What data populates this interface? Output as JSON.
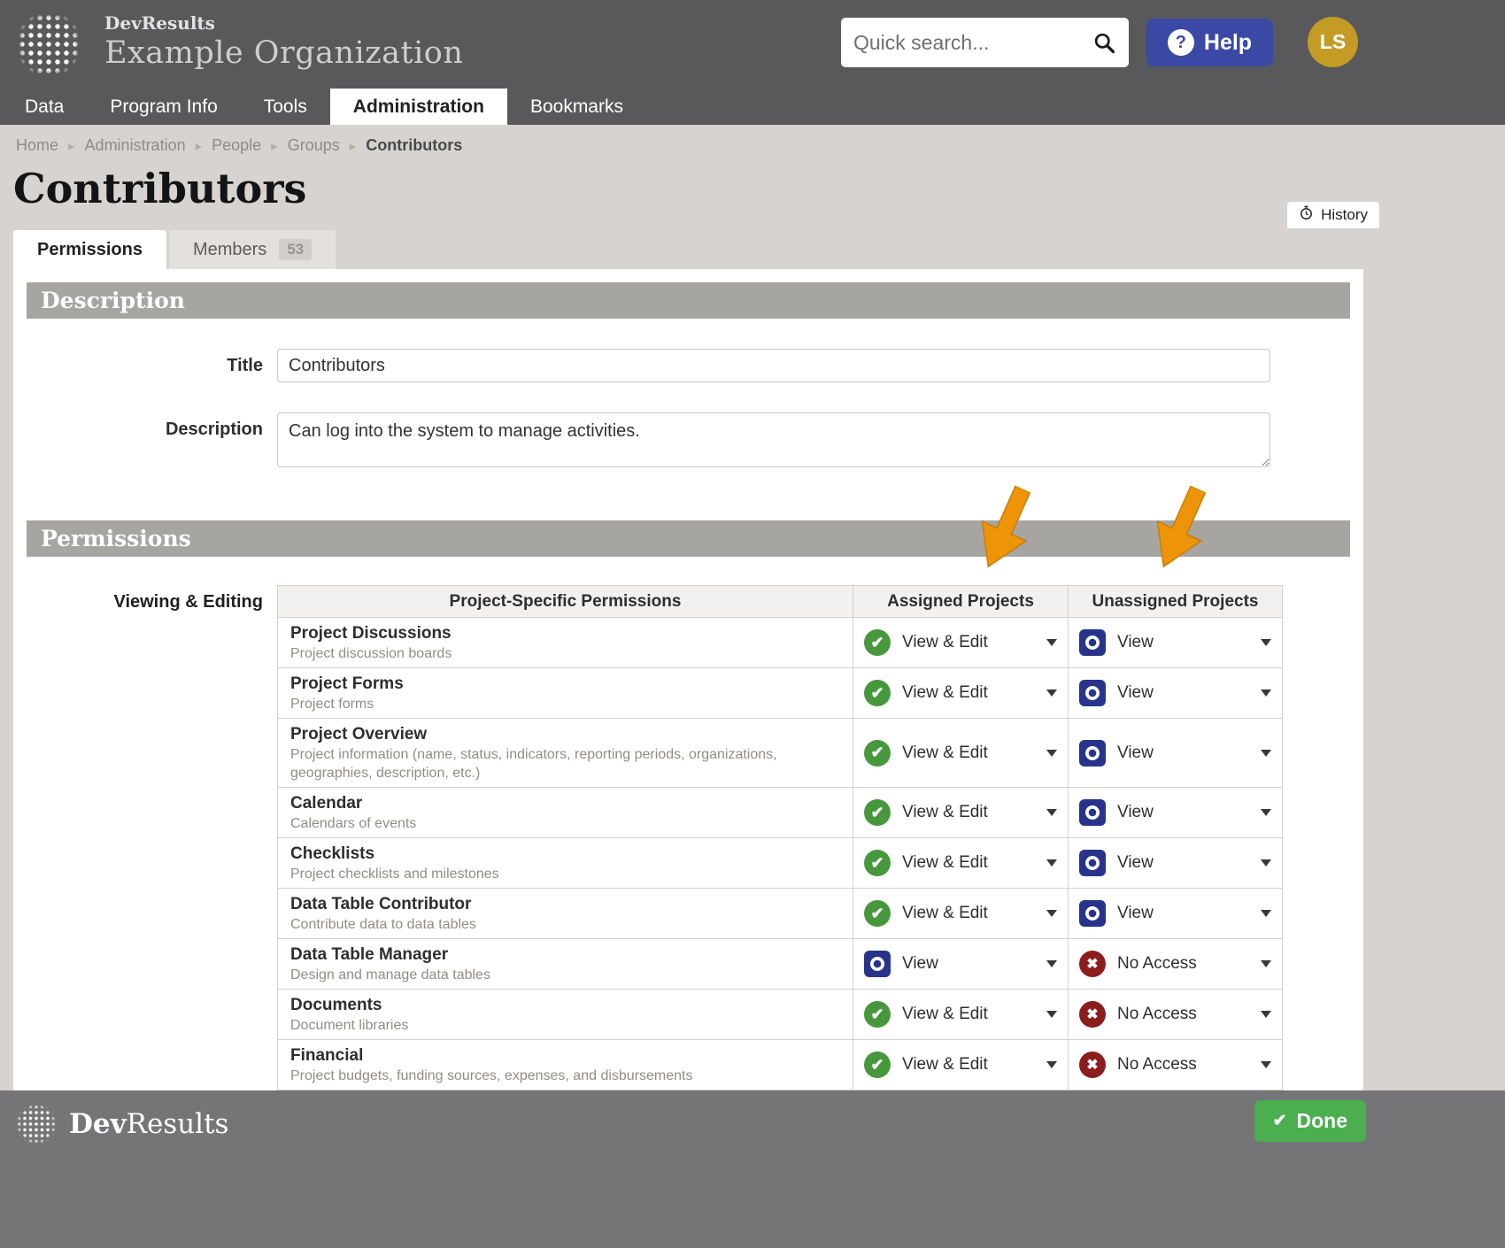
{
  "colors": {
    "header_gray": "#59595b",
    "accent_green": "#47983d",
    "accent_blue": "#28348b",
    "accent_red": "#8c1d1d",
    "arrow_orange": "#ee9408",
    "help_blue": "#3a49a3",
    "done_green": "#4bae4f",
    "avatar_gold": "#c49b25"
  },
  "header": {
    "app_name": "DevResults",
    "org_name": "Example Organization",
    "search_placeholder": "Quick search...",
    "help_label": "Help",
    "avatar_initials": "LS"
  },
  "nav": {
    "items": [
      {
        "label": "Data",
        "active": false
      },
      {
        "label": "Program Info",
        "active": false
      },
      {
        "label": "Tools",
        "active": false
      },
      {
        "label": "Administration",
        "active": true
      },
      {
        "label": "Bookmarks",
        "active": false
      }
    ]
  },
  "breadcrumb": {
    "items": [
      "Home",
      "Administration",
      "People",
      "Groups",
      "Contributors"
    ]
  },
  "page": {
    "title": "Contributors",
    "history_label": "History"
  },
  "tabs": {
    "permissions": {
      "label": "Permissions"
    },
    "members": {
      "label": "Members",
      "badge": "53"
    }
  },
  "description_section": {
    "header": "Description",
    "title_label": "Title",
    "title_value": "Contributors",
    "description_label": "Description",
    "description_value": "Can log into the system to manage activities."
  },
  "permissions_section": {
    "header": "Permissions",
    "group_label": "Viewing & Editing",
    "columns": [
      "Project-Specific Permissions",
      "Assigned Projects",
      "Unassigned Projects"
    ],
    "rows": [
      {
        "name": "Project Discussions",
        "desc": "Project discussion boards",
        "assigned": {
          "label": "View & Edit",
          "state": "view_edit"
        },
        "unassigned": {
          "label": "View",
          "state": "view"
        }
      },
      {
        "name": "Project Forms",
        "desc": "Project forms",
        "assigned": {
          "label": "View & Edit",
          "state": "view_edit"
        },
        "unassigned": {
          "label": "View",
          "state": "view"
        }
      },
      {
        "name": "Project Overview",
        "desc": "Project information (name, status, indicators, reporting periods, organizations, geographies, description, etc.)",
        "assigned": {
          "label": "View & Edit",
          "state": "view_edit"
        },
        "unassigned": {
          "label": "View",
          "state": "view"
        }
      },
      {
        "name": "Calendar",
        "desc": "Calendars of events",
        "assigned": {
          "label": "View & Edit",
          "state": "view_edit"
        },
        "unassigned": {
          "label": "View",
          "state": "view"
        }
      },
      {
        "name": "Checklists",
        "desc": "Project checklists and milestones",
        "assigned": {
          "label": "View & Edit",
          "state": "view_edit"
        },
        "unassigned": {
          "label": "View",
          "state": "view"
        }
      },
      {
        "name": "Data Table Contributor",
        "desc": "Contribute data to data tables",
        "assigned": {
          "label": "View & Edit",
          "state": "view_edit"
        },
        "unassigned": {
          "label": "View",
          "state": "view"
        }
      },
      {
        "name": "Data Table Manager",
        "desc": "Design and manage data tables",
        "assigned": {
          "label": "View",
          "state": "view"
        },
        "unassigned": {
          "label": "No Access",
          "state": "no_access"
        }
      },
      {
        "name": "Documents",
        "desc": "Document libraries",
        "assigned": {
          "label": "View & Edit",
          "state": "view_edit"
        },
        "unassigned": {
          "label": "No Access",
          "state": "no_access"
        }
      },
      {
        "name": "Financial",
        "desc": "Project budgets, funding sources, expenses, and disbursements",
        "assigned": {
          "label": "View & Edit",
          "state": "view_edit"
        },
        "unassigned": {
          "label": "No Access",
          "state": "no_access"
        }
      }
    ]
  },
  "footer": {
    "brand_bold": "Dev",
    "brand_rest": "Results",
    "done_label": "Done"
  }
}
